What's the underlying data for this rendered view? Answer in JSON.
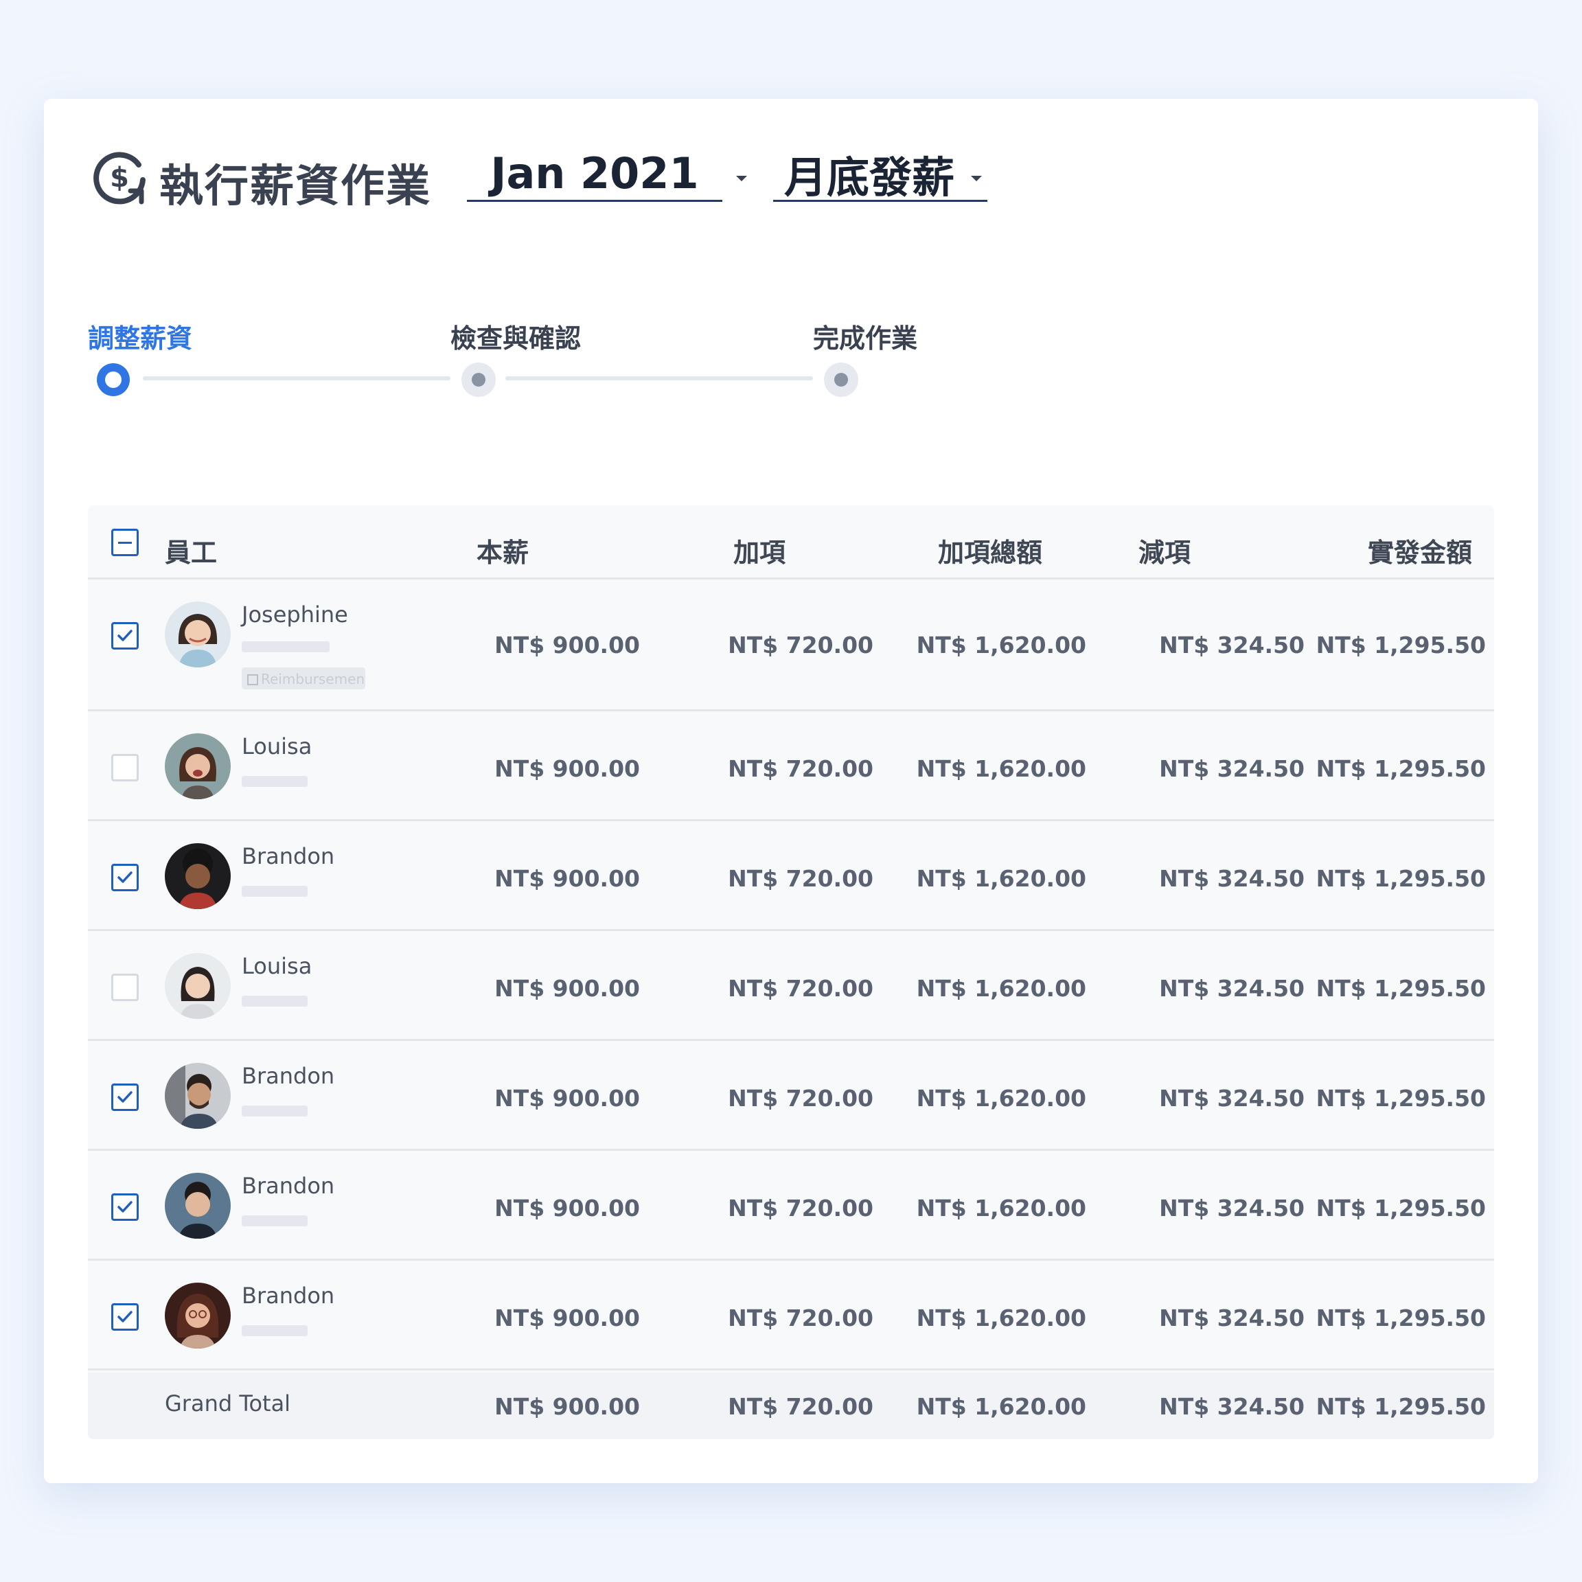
{
  "header": {
    "title": "執行薪資作業",
    "period": "Jan 2021",
    "payroll_type": "月底發薪"
  },
  "steps": [
    {
      "label": "調整薪資",
      "state": "active"
    },
    {
      "label": "檢查與確認",
      "state": "todo"
    },
    {
      "label": "完成作業",
      "state": "todo"
    }
  ],
  "table": {
    "columns": {
      "employee": "員工",
      "base": "本薪",
      "additions": "加項",
      "additions_total": "加項總額",
      "deductions": "減項",
      "net": "實發金額"
    },
    "rows": [
      {
        "name": "Josephine",
        "checked": true,
        "tag": "Reimbursement",
        "base": "NT$ 900.00",
        "additions": "NT$ 720.00",
        "additions_total": "NT$ 1,620.00",
        "deductions": "NT$ 324.50",
        "net": "NT$ 1,295.50"
      },
      {
        "name": "Louisa",
        "checked": false,
        "base": "NT$ 900.00",
        "additions": "NT$ 720.00",
        "additions_total": "NT$ 1,620.00",
        "deductions": "NT$ 324.50",
        "net": "NT$ 1,295.50"
      },
      {
        "name": "Brandon",
        "checked": true,
        "base": "NT$ 900.00",
        "additions": "NT$ 720.00",
        "additions_total": "NT$ 1,620.00",
        "deductions": "NT$ 324.50",
        "net": "NT$ 1,295.50"
      },
      {
        "name": "Louisa",
        "checked": false,
        "base": "NT$ 900.00",
        "additions": "NT$ 720.00",
        "additions_total": "NT$ 1,620.00",
        "deductions": "NT$ 324.50",
        "net": "NT$ 1,295.50"
      },
      {
        "name": "Brandon",
        "checked": true,
        "base": "NT$ 900.00",
        "additions": "NT$ 720.00",
        "additions_total": "NT$ 1,620.00",
        "deductions": "NT$ 324.50",
        "net": "NT$ 1,295.50"
      },
      {
        "name": "Brandon",
        "checked": true,
        "base": "NT$ 900.00",
        "additions": "NT$ 720.00",
        "additions_total": "NT$ 1,620.00",
        "deductions": "NT$ 324.50",
        "net": "NT$ 1,295.50"
      },
      {
        "name": "Brandon",
        "checked": true,
        "base": "NT$ 900.00",
        "additions": "NT$ 720.00",
        "additions_total": "NT$ 1,620.00",
        "deductions": "NT$ 324.50",
        "net": "NT$ 1,295.50"
      }
    ],
    "grand_total": {
      "label": "Grand Total",
      "base": "NT$ 900.00",
      "additions": "NT$ 720.00",
      "additions_total": "NT$ 1,620.00",
      "deductions": "NT$ 324.50",
      "net": "NT$ 1,295.50"
    }
  },
  "colors": {
    "accent": "#2f75e3",
    "checkbox": "#1f5fbf",
    "background": "#f1f6fd"
  }
}
